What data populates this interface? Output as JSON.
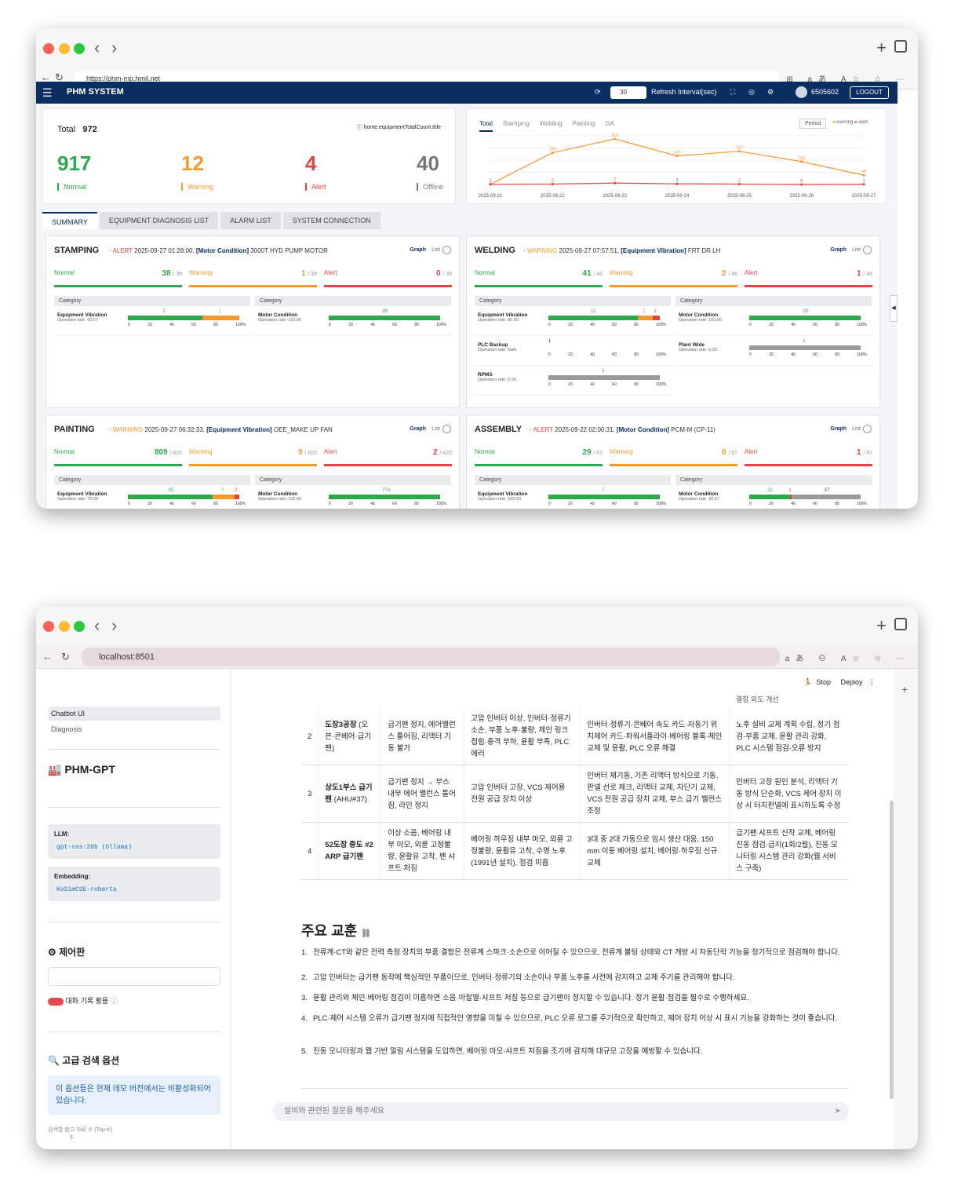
{
  "w1": {
    "url": "https://phm-mp.hmil.net",
    "app_title": "PHM SYSTEM",
    "interval_value": "30",
    "refresh_label": "Refresh Interval(sec)",
    "user": "6505602",
    "logout": "LOGOUT",
    "total_label": "Total",
    "total_value": "972",
    "count_note": "home.equipmentTotalCount.title",
    "counts": [
      {
        "value": "917",
        "label": "Normal",
        "color": "#2ea84f"
      },
      {
        "value": "12",
        "label": "Warning",
        "color": "#f39a2b"
      },
      {
        "value": "4",
        "label": "Alert",
        "color": "#e54242"
      },
      {
        "value": "40",
        "label": "Offline",
        "color": "#777777"
      }
    ],
    "chart_tabs": [
      "Total",
      "Stamping",
      "Welding",
      "Painting",
      "GA"
    ],
    "period": "Period",
    "legend": [
      "warning",
      "alert"
    ],
    "tabs": [
      "SUMMARY",
      "EQUIPMENT DIAGNOSIS LIST",
      "ALARM LIST",
      "SYSTEM CONNECTION"
    ],
    "graph": "Graph",
    "list": "List",
    "normal": "Normal",
    "warning": "Warning",
    "alert": "Alert",
    "category": "Category",
    "sections": [
      {
        "name": "STAMPING",
        "level": "ALERT",
        "level_color": "#e54242",
        "detail": "2025-09-27 01:28:00,",
        "tag": "[Motor Condition]",
        "equip": "3000T HYD PUMP MOTOR",
        "normal": "38",
        "warning": "1",
        "alert": "0",
        "total": "/ 39",
        "left": [
          {
            "name": "Equipment Vibration",
            "rate": "Operation rate :66.67",
            "segs": [
              {
                "v": 2,
                "c": "#2ea84f"
              },
              {
                "v": 1,
                "c": "#f39a2b"
              }
            ],
            "labels": [
              "2",
              "1"
            ]
          }
        ],
        "right": [
          {
            "name": "Motor Condition",
            "rate": "Operation rate :100.00",
            "segs": [
              {
                "v": 36,
                "c": "#2ea84f"
              }
            ],
            "labels": [
              "36"
            ]
          }
        ]
      },
      {
        "name": "WELDING",
        "level": "WARNING",
        "level_color": "#f39a2b",
        "detail": "2025-09-27 07:57:51,",
        "tag": "[Equipment Vibration]",
        "equip": "FRT DR LH",
        "normal": "41",
        "warning": "2",
        "alert": "1",
        "total": "/ 46",
        "left": [
          {
            "name": "Equipment Vibration",
            "rate": "Operation rate :80.00",
            "segs": [
              {
                "v": 12,
                "c": "#2ea84f"
              },
              {
                "v": 2,
                "c": "#f39a2b"
              },
              {
                "v": 1,
                "c": "#e54242"
              }
            ],
            "labels": [
              "12",
              "2",
              "1"
            ]
          },
          {
            "name": "PLC Backup",
            "rate": "Operation rate :NaN",
            "segs": [],
            "labels": [
              "1"
            ]
          },
          {
            "name": "RPMS",
            "rate": "Operation rate :0.00",
            "segs": [
              {
                "v": 1,
                "c": "#9a9a9a"
              }
            ],
            "labels": [
              "1"
            ]
          }
        ],
        "right": [
          {
            "name": "Motor Condition",
            "rate": "Operation rate :100.00",
            "segs": [
              {
                "v": 29,
                "c": "#2ea84f"
              }
            ],
            "labels": [
              "29"
            ]
          },
          {
            "name": "Plant Wide",
            "rate": "Operation rate :0.00",
            "segs": [
              {
                "v": 1,
                "c": "#9a9a9a"
              }
            ],
            "labels": [
              "1"
            ]
          }
        ]
      },
      {
        "name": "PAINTING",
        "level": "WARNING",
        "level_color": "#f39a2b",
        "detail": "2025-09-27 06:32:33,",
        "tag": "[Equipment Vibration]",
        "equip": "OEE_MAKE UP FAN",
        "normal": "809",
        "warning": "9",
        "alert": "2",
        "total": "/ 820",
        "left": [
          {
            "name": "Equipment Vibration",
            "rate": "Operation rate :76.09",
            "segs": [
              {
                "v": 35,
                "c": "#2ea84f"
              },
              {
                "v": 9,
                "c": "#f39a2b"
              },
              {
                "v": 2,
                "c": "#e54242"
              }
            ],
            "labels": [
              "35",
              "9",
              "2"
            ]
          }
        ],
        "right": [
          {
            "name": "Motor Condition",
            "rate": "Operation rate :100.00",
            "segs": [
              {
                "v": 774,
                "c": "#2ea84f"
              }
            ],
            "labels": [
              "774"
            ]
          }
        ]
      },
      {
        "name": "ASSEMBLY",
        "level": "ALERT",
        "level_color": "#e54242",
        "detail": "2025-09-22 02:00:31,",
        "tag": "[Motor Condition]",
        "equip": "PCM-M (CP-11)",
        "normal": "29",
        "warning": "0",
        "alert": "1",
        "total": "/ 67",
        "left": [
          {
            "name": "Equipment Vibration",
            "rate": "Operation rate :100.00",
            "segs": [
              {
                "v": 7,
                "c": "#2ea84f"
              }
            ],
            "labels": [
              "7"
            ]
          }
        ],
        "right": [
          {
            "name": "Motor Condition",
            "rate": "Operation rate :36.67",
            "segs": [
              {
                "v": 22,
                "c": "#2ea84f"
              },
              {
                "v": 1,
                "c": "#e54242"
              },
              {
                "v": 37,
                "c": "#9a9a9a"
              }
            ],
            "labels": [
              "22",
              "1",
              "37"
            ]
          }
        ]
      }
    ],
    "axis": [
      "0",
      "20",
      "40",
      "60",
      "80",
      "100%"
    ]
  },
  "chart_data": {
    "type": "line",
    "x": [
      "2025-09-21",
      "2025-09-22",
      "2025-09-23",
      "2025-09-24",
      "2025-09-25",
      "2025-09-26",
      "2025-09-27"
    ],
    "series": [
      {
        "name": "warning",
        "color": "#f39a2b",
        "values": [
          1,
          150,
          215,
          135,
          157,
          108,
          44
        ]
      },
      {
        "name": "alert",
        "color": "#e54242",
        "values": [
          1,
          2,
          7,
          3,
          2,
          0,
          1
        ]
      }
    ],
    "ylim": [
      0,
      230
    ],
    "legend": "top-right"
  },
  "w2": {
    "url": "localhost:8501",
    "stop": "Stop",
    "deploy": "Deploy",
    "nav": [
      "Chatbot UI",
      "Diagnosis"
    ],
    "brand": "PHM-GPT",
    "llm_label": "LLM:",
    "llm_value": "gpt-oss:20b (Ollama)",
    "emb_label": "Embedding:",
    "emb_value": "KoSimCSE-roberta",
    "panel_title": "제어판",
    "toggle_label": "대화 기록 활용",
    "adv_title": "고급 검색 옵션",
    "adv_info": "이 옵션들은 현재 데모 버전에서는 비활성화되어 있습니다.",
    "slider_label": "검색할 참고 자료 수 (Top-K)",
    "slider_value": "5",
    "top_fragment": "결함 외도 개선",
    "rows": [
      {
        "no": "2",
        "name": "도장3공장",
        "name2": "(오븐·콘베어·급기팬)",
        "symptom": "급기팬 정지, 에어밸런스 틀어짐, 리액터 기동 불가",
        "cause": "고압 인버터 이상, 인버터·정류기 소손, 부품 노후·불량, 체인 링크 접힘·충격 부하, 윤활 부족, PLC 에러",
        "action": "인버터·정류기·콘베어 속도 카드·자동기 위치제어 카드·파워서플라이·베어링 블록·체인 교체 및 윤활, PLC 오류 해결",
        "prevent": "노후 설비 교체 계획 수립, 정기 점검·부품 교체, 윤활 관리 강화, PLC 시스템 점검·오류 방지"
      },
      {
        "no": "3",
        "name": "상도1부스 급기팬",
        "name2": "(AHU#37)",
        "symptom": "급기팬 정지 → 부스 내부 에어 밸런스 틀어짐, 라인 정지",
        "cause": "고압 인버터 고장, VCS 제어용 전원 공급 장치 이상",
        "action": "인버터 재기동, 기존 리액터 방식으로 기동, 판넬 선로 체크, 리액터 교체, 차단기 교체, VCS 전원 공급 장치 교체, 부스 급기 밸런스 조정",
        "prevent": "인버터 고장 원인 분석, 리액터 기동 방식 단순화, VCS 제어 장치 이상 시 터치판넬에 표시하도록 수정"
      },
      {
        "no": "4",
        "name": "52도장 중도 #2 ARP 급기팬",
        "name2": "",
        "symptom": "이상 소음, 베어링 내부 마모, 외륜 고정불량, 윤활유 고착, 팬 샤프트 처짐",
        "cause": "베어링 하우징 내부 마모, 외륜 고정불량, 윤활유 고착, 수명 노후(1991년 설치), 점검 미흡",
        "action": "3대 중 2대 가동으로 임시 생산 대응, 150 mm 이동 베어링 설치, 베어링·하우징 신규 교체",
        "prevent": "급기팬 샤프트 신작 교체, 베어링 진동 점검·급지(1회/2월), 진동 모니터링 시스템 관리 강화(웹 서비스 구축)"
      }
    ],
    "heading": "주요 교훈",
    "lessons": [
      "전류계·CT와 같은 전력 측정 장치의 부품 결함은 전류계 스파크·소손으로 이어질 수 있으므로, 전류계 볼팅 상태와 CT 개방 시 자동단락 기능을 정기적으로 점검해야 합니다.",
      "고압 인버터는 급기팬 동작에 핵심적인 부품이므로, 인버터·정류기의 소손이나 부품 노후를 사전에 감지하고 교체 주기를 관리해야 합니다.",
      "윤활 관리와 체인·베어링 점검이 미흡하면 소음·마찰열·샤프트 처짐 등으로 급기팬이 정지할 수 있습니다. 정기 윤활·점검을 필수로 수행하세요.",
      "PLC·제어 시스템 오류가 급기팬 정지에 직접적인 영향을 미칠 수 있으므로, PLC 오류 로그를 주기적으로 확인하고, 제어 장치 이상 시 표시 기능을 강화하는 것이 좋습니다.",
      "진동 모니터링과 웹 기반 알림 시스템을 도입하면, 베어링 마모·샤프트 처짐을 조기에 감지해 대규모 고장을 예방할 수 있습니다."
    ],
    "chat_placeholder": "설비와 관련된 질문을 해주세요"
  }
}
